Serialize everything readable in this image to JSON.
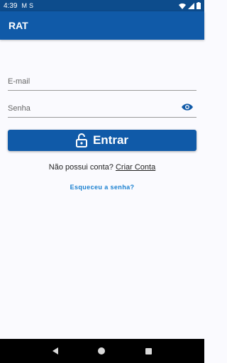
{
  "status_bar": {
    "time": "4:39",
    "icons": [
      "gmail-icon",
      "s-icon",
      "wifi-icon",
      "signal-icon",
      "battery-icon"
    ]
  },
  "app_bar": {
    "title": "RAT"
  },
  "form": {
    "email_placeholder": "E-mail",
    "password_placeholder": "Senha",
    "login_label": "Entrar",
    "no_account_text": "Não possui conta?",
    "create_account_label": "Criar Conta",
    "forgot_password_label": "Esqueceu a senha?"
  },
  "colors": {
    "primary": "#105aa8",
    "status_bar": "#0d4c8c",
    "link": "#1a80d0",
    "background": "#fafafe"
  }
}
